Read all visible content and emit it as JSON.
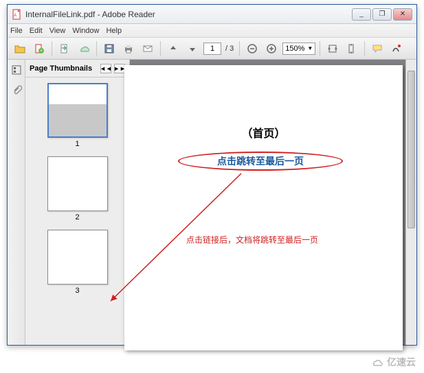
{
  "window": {
    "title": "InternalFileLink.pdf - Adobe Reader",
    "min_label": "_",
    "max_label": "❐",
    "close_label": "✕"
  },
  "menu": {
    "file": "File",
    "edit": "Edit",
    "view": "View",
    "window": "Window",
    "help": "Help"
  },
  "toolbar": {
    "page_current": "1",
    "page_total": "/ 3",
    "zoom": "150%"
  },
  "panel": {
    "title": "Page Thumbnails",
    "prev": "◄◄",
    "next": "►►",
    "thumbs": [
      {
        "num": "1",
        "selected": true
      },
      {
        "num": "2",
        "selected": false
      },
      {
        "num": "3",
        "selected": false
      }
    ]
  },
  "document": {
    "title": "（首页）",
    "link": "点击跳转至最后一页",
    "annotation": "点击链接后，文档将跳转至最后一页"
  },
  "watermark": "亿速云"
}
